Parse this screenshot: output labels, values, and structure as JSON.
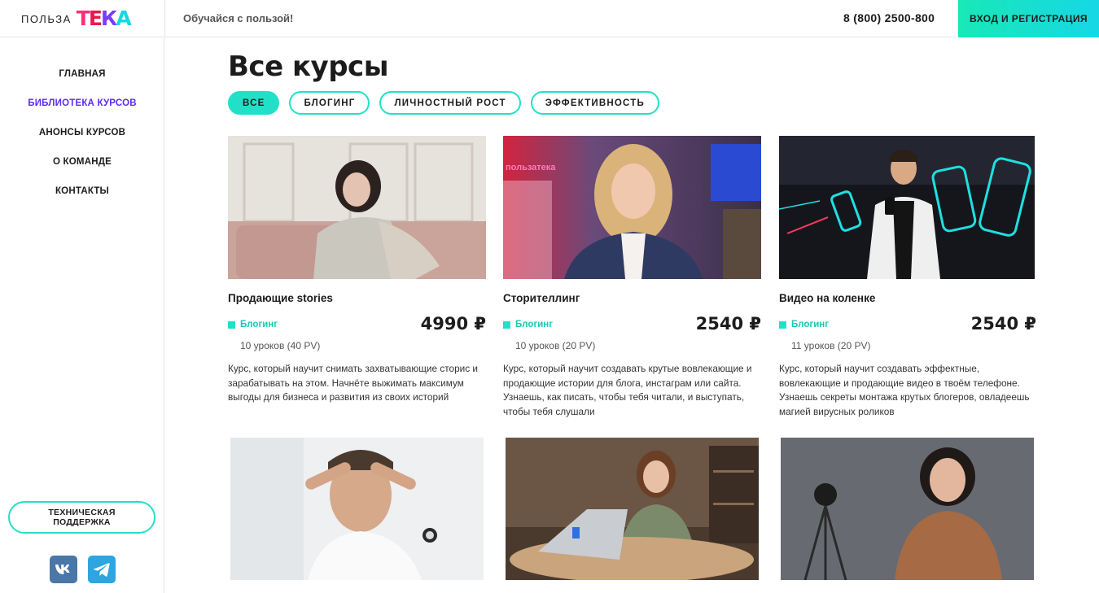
{
  "header": {
    "logo_word": "ПОЛЬЗА",
    "logo_mark_letters": [
      "Т",
      "Е",
      "К",
      "А"
    ],
    "tagline": "Обучайся с пользой!",
    "phone": "8 (800) 2500-800",
    "login_label": "ВХОД И РЕГИСТРАЦИЯ",
    "accent_color": "#22e0c8"
  },
  "sidebar": {
    "items": [
      {
        "label": "ГЛАВНАЯ",
        "active": false
      },
      {
        "label": "БИБЛИОТЕКА КУРСОВ",
        "active": true
      },
      {
        "label": "АНОНСЫ КУРСОВ",
        "active": false
      },
      {
        "label": "О КОМАНДЕ",
        "active": false
      },
      {
        "label": "КОНТАКТЫ",
        "active": false
      }
    ],
    "support_label": "ТЕХНИЧЕСКАЯ ПОДДЕРЖКА",
    "social": [
      {
        "icon": "vk-icon",
        "color": "#4a76a8"
      },
      {
        "icon": "telegram-icon",
        "color": "#2ca5e0"
      }
    ]
  },
  "main": {
    "title": "Все курсы",
    "filters": [
      {
        "label": "ВСЕ",
        "active": true
      },
      {
        "label": "БЛОГИНГ",
        "active": false
      },
      {
        "label": "ЛИЧНОСТНЫЙ РОСТ",
        "active": false
      },
      {
        "label": "ЭФФЕКТИВНОСТЬ",
        "active": false
      }
    ],
    "courses": [
      {
        "title": "Продающие stories",
        "category": "Блогинг",
        "price": "4990 ₽",
        "lessons": "10 уроков (40 PV)",
        "description": "Курс, который научит снимать захватывающие сторис и зарабатывать на этом. Начнёте выжимать максимум выгоды для бизнеса и развития из своих историй"
      },
      {
        "title": "Сторителлинг",
        "category": "Блогинг",
        "price": "2540 ₽",
        "lessons": "10 уроков (20 PV)",
        "description": "Курс, который научит создавать крутые вовлекающие и продающие истории для блога, инстаграм или сайта. Узнаешь, как писать, чтобы тебя читали, и выступать, чтобы тебя слушали"
      },
      {
        "title": "Видео на коленке",
        "category": "Блогинг",
        "price": "2540 ₽",
        "lessons": "11 уроков (20 PV)",
        "description": "Курс, который научит создавать эффектные, вовлекающие и продающие видео в твоём телефоне. Узнаешь секреты монтажа крутых блогеров, овладеешь магией вирусных роликов"
      }
    ],
    "thumb_overlay_text": "пользатека"
  }
}
